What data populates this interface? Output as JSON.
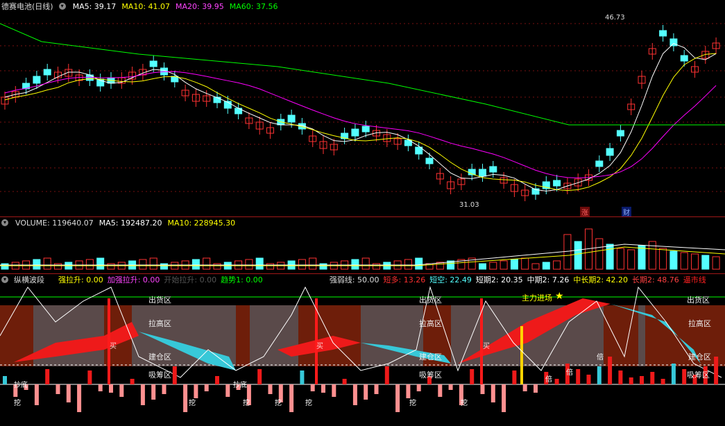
{
  "kline": {
    "title": "德赛电池(日线)",
    "ma5": "MA5: 39.17",
    "ma10": "MA10: 41.07",
    "ma20": "MA20: 39.95",
    "ma60": "MA60: 37.56",
    "high_label": "46.73",
    "low_label": "31.03",
    "badge_zhang": "涨",
    "badge_cai": "财"
  },
  "volume": {
    "vol": "VOLUME: 119640.07",
    "ma5": "MA5: 192487.20",
    "ma10": "MA10: 228945.30"
  },
  "indicator": {
    "name": "纵横波段",
    "qls": "强拉升: 0.00",
    "jqls": "加强拉升: 0.00",
    "kslh": "开始拉升: 0.00",
    "qs": "趋势1: 0.00",
    "qrx": "强弱线: 50.00",
    "dd": "短多: 13.26",
    "dk": "短空: 22.49",
    "dq2": "短期2: 20.35",
    "zq2": "中期2: 7.26",
    "zcq2": "中长期2: 42.20",
    "cq2": "长期2: 48.76",
    "tail": "逼市线",
    "zones": {
      "chuhuo": "出货区",
      "lagao": "拉高区",
      "jiancang": "建仓区",
      "xichou": "吸筹区",
      "zhuli": "主力进场",
      "star": "★",
      "mai": "买",
      "bei": "倍",
      "wa": "挖",
      "chaodi": "抄底"
    }
  },
  "colors": {
    "up": "#ff3232",
    "down": "#54ffff",
    "ma5": "#ffffff",
    "ma10": "#ffff00",
    "ma20": "#ff00ff",
    "ma60": "#00ff00",
    "grid": "#7a1010"
  }
}
